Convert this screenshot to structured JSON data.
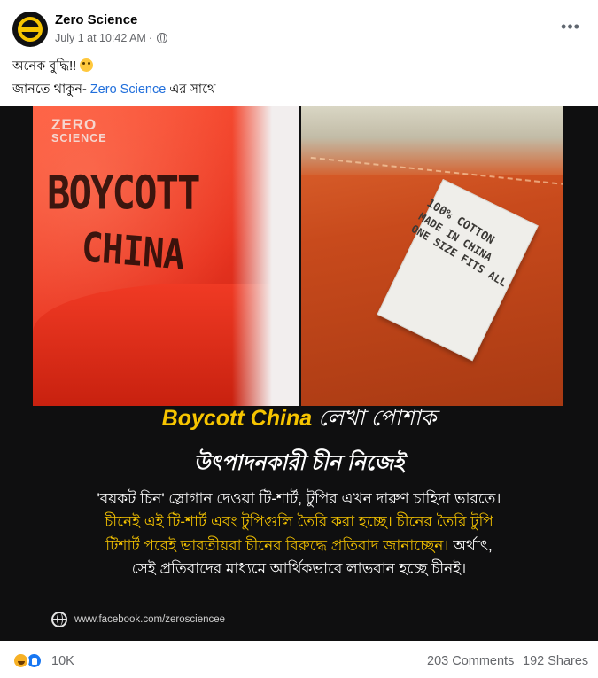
{
  "post": {
    "author": "Zero Science",
    "timestamp": "July 1 at 10:42 AM",
    "separator": "·",
    "privacy_icon": "globe-icon",
    "more_label": "•••"
  },
  "caption": {
    "line1": "অনেক বুদ্ধি!!",
    "line1_emoji": "flushed-face-emoji",
    "line2_prefix": "জানতে থাকুন- ",
    "line2_link": "Zero Science",
    "line2_suffix": " এর সাথে"
  },
  "image": {
    "logo_top": "ZERO",
    "logo_bottom": "SCIENCE",
    "cap_text_1": "BOYCOTT",
    "cap_text_2": "CHINA",
    "tag_line1": "100% COTTON",
    "tag_line2": "MADE IN CHINA",
    "tag_line3": "ONE SIZE FITS ALL",
    "headline_en": "Boycott China",
    "headline_bn_1": " লেখা পোশাক",
    "headline_bn_2": "উৎপাদনকারী চীন নিজেই",
    "body_line1": "'বয়কট চিন' স্লোগান দেওয়া টি-শার্ট, টুপির এখন দারুণ চাহিদা ভারতে।",
    "body_line2": "চীনেই এই টি-শার্ট এবং টুপিগুলি তৈরি করা হচ্ছে। চীনের তৈরি টুপি",
    "body_line3_yellow": "টিশার্ট পরেই ভারতীয়রা চীনের বিরুদ্ধে প্রতিবাদ জানাচ্ছেন।",
    "body_line3_white": " অর্থাৎ,",
    "body_line4": "সেই প্রতিবাদের মাধ্যমে আর্থিকভাবে লাভবান হচ্ছে চীনই।",
    "watermark": "www.facebook.com/zerosciencee",
    "accent_yellow": "#f6c400"
  },
  "footer": {
    "reaction_count": "10K",
    "comments": "203 Comments",
    "shares": "192 Shares"
  },
  "colors": {
    "link_blue": "#216fdb",
    "secondary_text": "#65676b",
    "like_blue": "#1877f2"
  }
}
